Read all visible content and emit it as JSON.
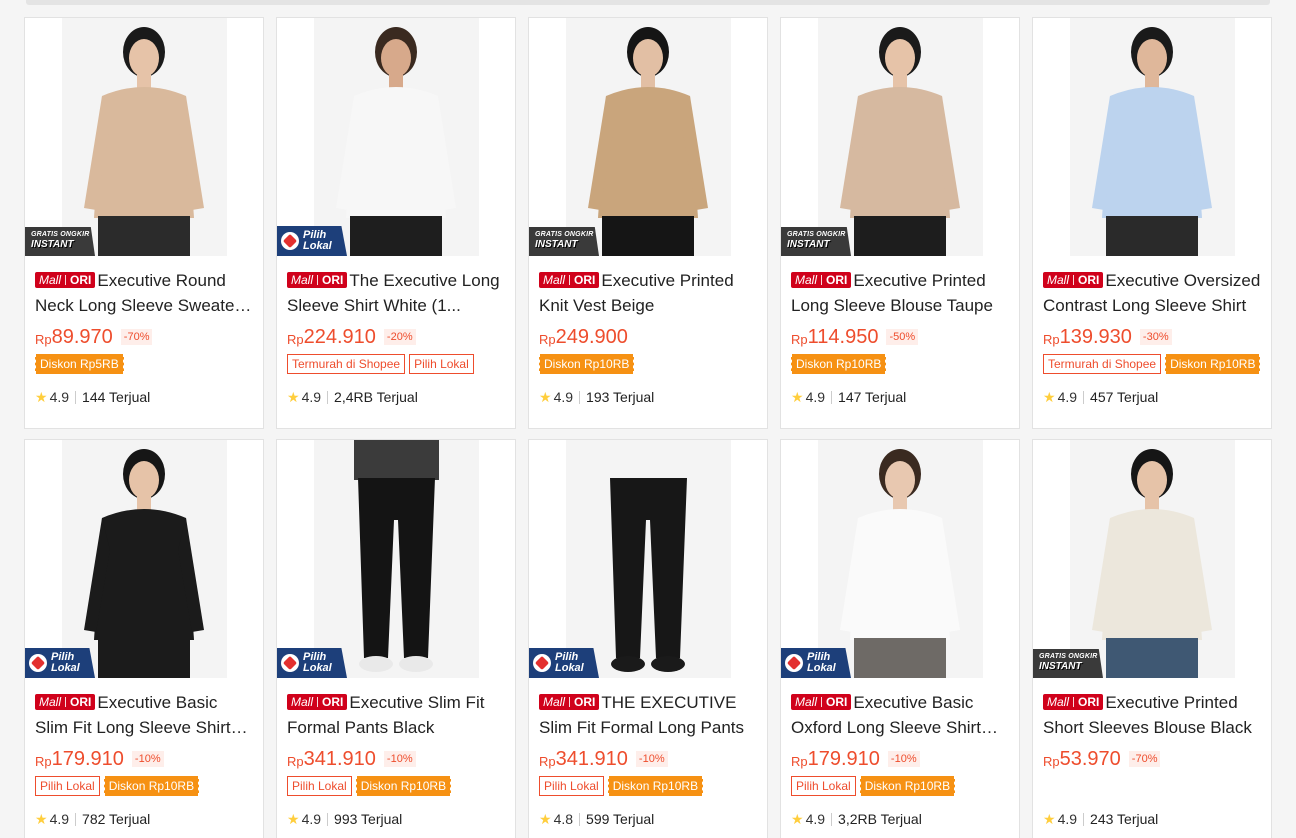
{
  "currency": "Rp",
  "overlays": {
    "instant_line1": "GRATIS ONGKIR",
    "instant_line2": "INSTANT",
    "lokal_line1": "Pilih",
    "lokal_line2": "Lokal"
  },
  "mall_badge": {
    "mall": "Mall",
    "ori": "ORI"
  },
  "colors": {
    "accent": "#ee4d2d",
    "mall": "#d0011b",
    "orange_tag": "#f69113",
    "star": "#ffce3d",
    "lokal_badge": "#1d3f7a"
  },
  "products": [
    {
      "title": "Executive Round Neck Long Sleeve Sweater Beige",
      "price": "89.970",
      "discount": "-70%",
      "overlay": "instant",
      "tags": [
        {
          "text": "Diskon Rp5RB",
          "style": "orange"
        }
      ],
      "rating": "4.9",
      "sold": "144 Terjual",
      "image": "sweater-beige",
      "colors": {
        "skin": "#e6c3a8",
        "hair": "#1a1a1a",
        "top": "#d9b99c",
        "bottom": "#2b2b2b"
      }
    },
    {
      "title": "The Executive Long Sleeve Shirt White (1...",
      "price": "224.910",
      "discount": "-20%",
      "overlay": "lokal",
      "tags": [
        {
          "text": "Termurah di Shopee",
          "style": "outline"
        },
        {
          "text": "Pilih Lokal",
          "style": "outline"
        }
      ],
      "rating": "4.9",
      "sold": "2,4RB Terjual",
      "image": "shirt-white-man",
      "colors": {
        "skin": "#d7a98b",
        "hair": "#3a2a20",
        "top": "#f7f7f7",
        "bottom": "#1e1e1e"
      }
    },
    {
      "title": "Executive Printed Knit Vest Beige",
      "price": "249.900",
      "discount": "",
      "overlay": "instant",
      "tags": [
        {
          "text": "Diskon Rp10RB",
          "style": "orange"
        }
      ],
      "rating": "4.9",
      "sold": "193 Terjual",
      "image": "knit-vest",
      "colors": {
        "skin": "#e2bfa4",
        "hair": "#151515",
        "top": "#c9a57c",
        "bottom": "#151515"
      }
    },
    {
      "title": "Executive Printed Long Sleeve Blouse Taupe",
      "price": "114.950",
      "discount": "-50%",
      "overlay": "instant",
      "tags": [
        {
          "text": "Diskon Rp10RB",
          "style": "orange"
        }
      ],
      "rating": "4.9",
      "sold": "147 Terjual",
      "image": "blouse-taupe",
      "colors": {
        "skin": "#e6c3a8",
        "hair": "#1a1a1a",
        "top": "#d6b9a0",
        "bottom": "#1d1d1d"
      }
    },
    {
      "title": "Executive Oversized Contrast Long Sleeve Shirt",
      "price": "139.930",
      "discount": "-30%",
      "overlay": "",
      "tags": [
        {
          "text": "Termurah di Shopee",
          "style": "outline"
        },
        {
          "text": "Diskon Rp10RB",
          "style": "orange"
        }
      ],
      "rating": "4.9",
      "sold": "457 Terjual",
      "image": "shirt-blue",
      "colors": {
        "skin": "#dfb79a",
        "hair": "#1a1a1a",
        "top": "#bcd3ee",
        "bottom": "#2a2a2a"
      }
    },
    {
      "title": "Executive Basic Slim Fit Long Sleeve Shirt Black",
      "price": "179.910",
      "discount": "-10%",
      "overlay": "lokal",
      "tags": [
        {
          "text": "Pilih Lokal",
          "style": "outline"
        },
        {
          "text": "Diskon Rp10RB",
          "style": "orange"
        }
      ],
      "rating": "4.9",
      "sold": "782 Terjual",
      "image": "shirt-black-woman",
      "colors": {
        "skin": "#e6c3a8",
        "hair": "#161616",
        "top": "#1b1b1b",
        "bottom": "#1b1b1b"
      }
    },
    {
      "title": "Executive Slim Fit Formal Pants Black",
      "price": "341.910",
      "discount": "-10%",
      "overlay": "lokal",
      "tags": [
        {
          "text": "Pilih Lokal",
          "style": "outline"
        },
        {
          "text": "Diskon Rp10RB",
          "style": "orange"
        }
      ],
      "rating": "4.9",
      "sold": "993 Terjual",
      "image": "pants-black",
      "colors": {
        "skin": "#d7a98b",
        "hair": "#222",
        "top": "#3b3b3b",
        "bottom": "#141414"
      }
    },
    {
      "title": "THE EXECUTIVE Slim Fit Formal Long Pants",
      "price": "341.910",
      "discount": "-10%",
      "overlay": "lokal",
      "tags": [
        {
          "text": "Pilih Lokal",
          "style": "outline"
        },
        {
          "text": "Diskon Rp10RB",
          "style": "orange"
        }
      ],
      "rating": "4.8",
      "sold": "599 Terjual",
      "image": "pants-formal",
      "colors": {
        "skin": "#d7a98b",
        "hair": "#222",
        "top": "#f4f4f4",
        "bottom": "#171717"
      }
    },
    {
      "title": "Executive Basic Oxford Long Sleeve Shirt White",
      "price": "179.910",
      "discount": "-10%",
      "overlay": "lokal",
      "tags": [
        {
          "text": "Pilih Lokal",
          "style": "outline"
        },
        {
          "text": "Diskon Rp10RB",
          "style": "orange"
        }
      ],
      "rating": "4.9",
      "sold": "3,2RB Terjual",
      "image": "shirt-oxford",
      "colors": {
        "skin": "#e8c8b0",
        "hair": "#3a2a20",
        "top": "#fafafa",
        "bottom": "#6e6a66"
      }
    },
    {
      "title": "Executive Printed Short Sleeves Blouse Black",
      "price": "53.970",
      "discount": "-70%",
      "overlay": "instant",
      "tags": [],
      "rating": "4.9",
      "sold": "243 Terjual",
      "image": "blouse-printed",
      "colors": {
        "skin": "#e6c3a8",
        "hair": "#161616",
        "top": "#ece7dc",
        "bottom": "#3f5873"
      }
    }
  ]
}
